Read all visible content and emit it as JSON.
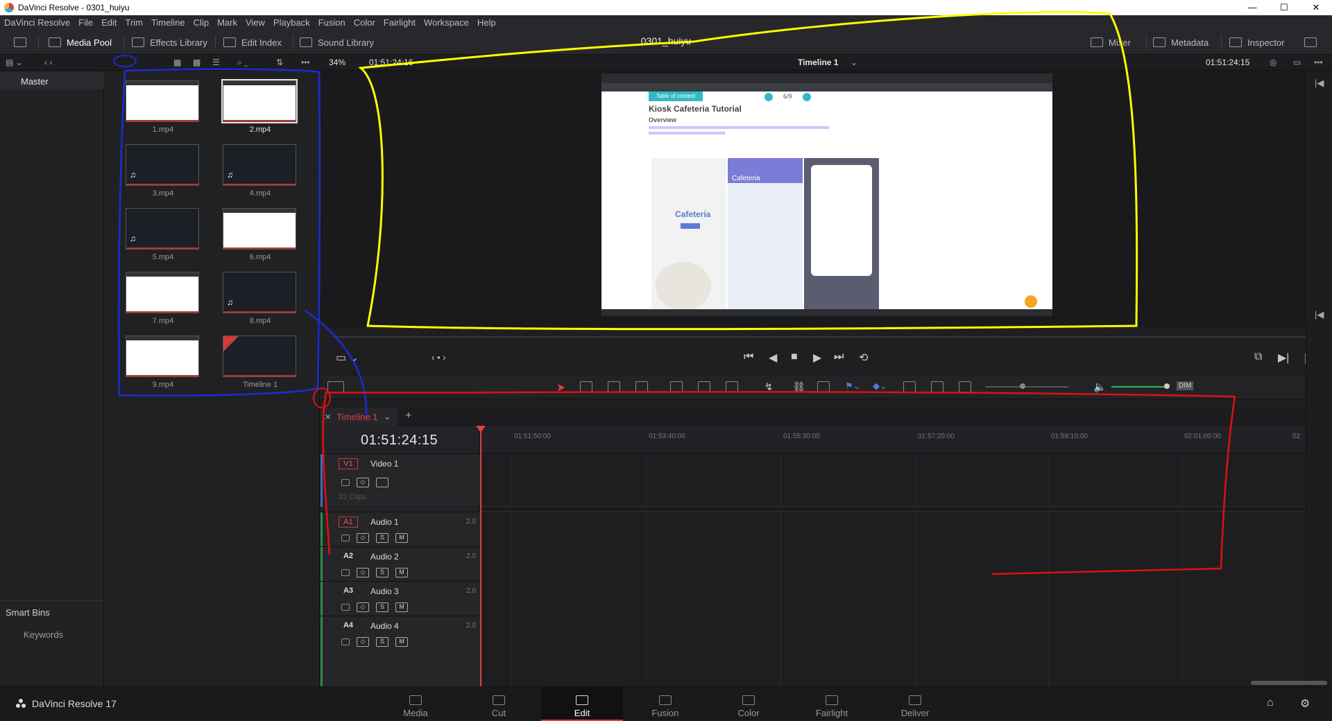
{
  "window": {
    "title": "DaVinci Resolve - 0301_huiyu",
    "controls": [
      "—",
      "☐",
      "✕"
    ]
  },
  "menu": [
    "DaVinci Resolve",
    "File",
    "Edit",
    "Trim",
    "Timeline",
    "Clip",
    "Mark",
    "View",
    "Playback",
    "Fusion",
    "Color",
    "Fairlight",
    "Workspace",
    "Help"
  ],
  "toolbar": {
    "media_pool": "Media Pool",
    "effects_library": "Effects Library",
    "edit_index": "Edit Index",
    "sound_library": "Sound Library",
    "project_name": "0301_huiyu",
    "mixer": "Mixer",
    "metadata": "Metadata",
    "inspector": "Inspector"
  },
  "viewer": {
    "zoom": "34%",
    "source_timecode": "01:51:24:16",
    "timeline_name": "Timeline 1",
    "record_timecode": "01:51:24:15"
  },
  "bins": {
    "master": "Master",
    "smart_bins": "Smart Bins",
    "keywords": "Keywords"
  },
  "clips": [
    {
      "name": "1.mp4",
      "style": "web"
    },
    {
      "name": "2.mp4",
      "style": "web-sel"
    },
    {
      "name": "3.mp4",
      "style": "dark-audio"
    },
    {
      "name": "4.mp4",
      "style": "dark-audio"
    },
    {
      "name": "5.mp4",
      "style": "dark-audio"
    },
    {
      "name": "6.mp4",
      "style": "web-audio"
    },
    {
      "name": "7.mp4",
      "style": "web"
    },
    {
      "name": "8.mp4",
      "style": "dark-audio"
    },
    {
      "name": "9.mp4",
      "style": "web"
    },
    {
      "name": "Timeline 1",
      "style": "timeline"
    }
  ],
  "preview": {
    "toc_button": "Table of content",
    "page": "6/9",
    "heading": "Kiosk Cafeteria Tutorial",
    "overview": "Overview",
    "cafeteria": "Cafeteria",
    "cafeteria2": "Cafeteria"
  },
  "timeline": {
    "tab": "Timeline 1",
    "timecode": "01:51:24:15",
    "ruler": [
      "01:51:50:00",
      "01:53:40:00",
      "01:55:30:00",
      "01:57:20:00",
      "01:59:10:00",
      "02:01:00:00",
      "02"
    ],
    "tracks": [
      {
        "tag": "V1",
        "name": "Video 1",
        "ch": "",
        "info": "32 Clips"
      },
      {
        "tag": "A1",
        "name": "Audio 1",
        "ch": "2.0"
      },
      {
        "tag": "A2",
        "name": "Audio 2",
        "ch": "2.0"
      },
      {
        "tag": "A3",
        "name": "Audio 3",
        "ch": "2.0"
      },
      {
        "tag": "A4",
        "name": "Audio 4",
        "ch": "2.0"
      }
    ],
    "dim": "DIM"
  },
  "pages": {
    "brand": "DaVinci Resolve 17",
    "items": [
      "Media",
      "Cut",
      "Edit",
      "Fusion",
      "Color",
      "Fairlight",
      "Deliver"
    ],
    "active": "Edit"
  },
  "colors": {
    "accent": "#e04040",
    "annot_yellow": "#ffff00",
    "annot_blue": "#1c2bd6",
    "annot_red": "#e01010"
  }
}
